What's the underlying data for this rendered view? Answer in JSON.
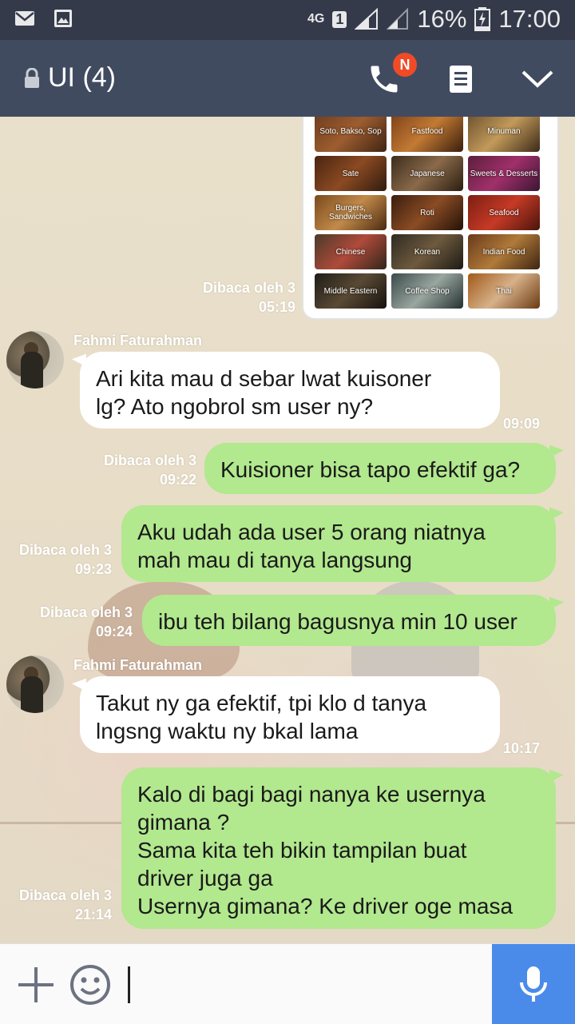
{
  "status_bar": {
    "network": "4G",
    "sim": "1",
    "battery": "16%",
    "time": "17:00"
  },
  "header": {
    "title": "UI (4)",
    "call_badge": "N"
  },
  "food_card": {
    "tiles": [
      "Soto, Bakso, Sop",
      "Fastfood",
      "Minuman",
      "Sate",
      "Japanese",
      "Sweets & Desserts",
      "Burgers, Sandwiches",
      "Roti",
      "Seafood",
      "Chinese",
      "Korean",
      "Indian Food",
      "Middle Eastern",
      "Coffee Shop",
      "Thai"
    ],
    "read_label": "Dibaca oleh 3",
    "read_time": "05:19"
  },
  "messages": [
    {
      "side": "in",
      "sender": "Fahmi Faturahman",
      "text": "Ari kita mau d sebar lwat kuisoner\nlg? Ato ngobrol sm user ny?",
      "time": "09:09"
    },
    {
      "side": "out",
      "read": "Dibaca oleh 3",
      "time": "09:22",
      "text": "Kuisioner bisa tapo efektif ga?"
    },
    {
      "side": "out",
      "read": "Dibaca oleh 3",
      "time": "09:23",
      "text": "Aku udah ada user 5 orang niatnya\nmah mau di tanya langsung"
    },
    {
      "side": "out",
      "read": "Dibaca oleh 3",
      "time": "09:24",
      "text": "ibu teh bilang bagusnya min 10 user"
    },
    {
      "side": "in",
      "sender": "Fahmi Faturahman",
      "text": "Takut ny ga efektif, tpi klo d tanya\nlngsng waktu ny bkal lama",
      "time": "10:17"
    },
    {
      "side": "out",
      "read": "Dibaca oleh 3",
      "time": "21:14",
      "text": "Kalo di bagi bagi nanya ke usernya\ngimana ?\nSama kita teh bikin tampilan buat\ndriver juga ga\nUsernya gimana? Ke driver oge masa"
    }
  ],
  "input": {
    "value": "",
    "placeholder": ""
  },
  "colors": {
    "header": "#414b60",
    "status_bar": "#353a4a",
    "outgoing_bubble": "#b2e88e",
    "incoming_bubble": "#ffffff",
    "mic_button": "#4a8bea",
    "badge": "#ef4b27"
  },
  "icons": {
    "status_left": [
      "mail-icon",
      "image-icon"
    ],
    "header": [
      "lock-icon",
      "phone-icon",
      "notes-icon",
      "chevron-down-icon"
    ],
    "input": [
      "plus-icon",
      "emoji-icon",
      "mic-icon"
    ]
  }
}
